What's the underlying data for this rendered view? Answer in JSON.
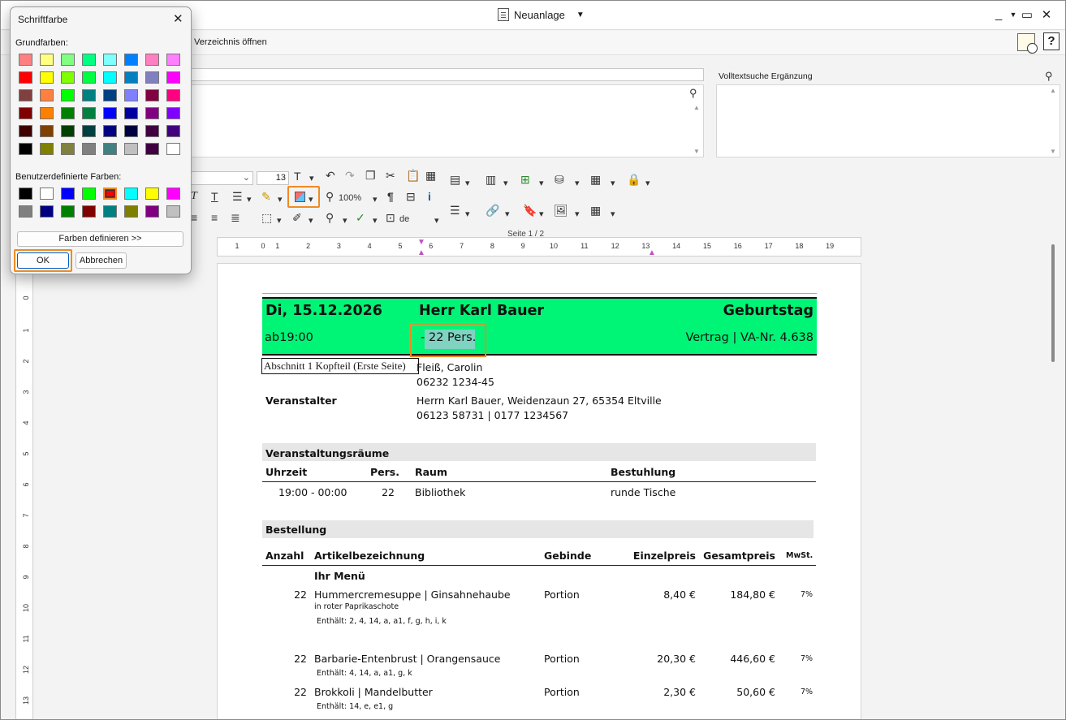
{
  "window": {
    "title": "Neuanlage",
    "menu_link": "Verzeichnis öffnen",
    "help_label": "?"
  },
  "search": {
    "fulltext_label": "Volltextsuche Ergänzung"
  },
  "toolbar": {
    "font_size": "13",
    "zoom": "100%",
    "language": "de",
    "page_indicator": "Seite 1 / 2"
  },
  "ruler": {
    "h_labels": [
      "1",
      "1",
      "2",
      "3",
      "4",
      "5",
      "6",
      "7",
      "8",
      "9",
      "10",
      "11",
      "12",
      "13",
      "14",
      "15",
      "16",
      "17",
      "18",
      "19"
    ],
    "v_labels": [
      "1",
      "1",
      "2",
      "3",
      "4",
      "5",
      "6",
      "7",
      "8",
      "9",
      "10",
      "11",
      "12",
      "13"
    ]
  },
  "document": {
    "header": {
      "date": "Di, 15.12.2026",
      "guest": "Herr Karl Bauer",
      "occasion": "Geburtstag",
      "time": "ab19:00",
      "dash": "-",
      "persons": "22 Pers.",
      "contract": "Vertrag | VA-Nr. 4.638"
    },
    "section_label": "Abschnitt 1 Kopfteil (Erste Seite)",
    "contact_name": "Fleiß, Carolin",
    "contact_phone": "06232 1234-45",
    "organizer_label": "Veranstalter",
    "organizer_address": "Herrn Karl Bauer, Weidenzaun 27, 65354 Eltville",
    "organizer_phone": "06123 58731 | 0177 1234567",
    "rooms": {
      "title": "Veranstaltungsräume",
      "headers": {
        "time": "Uhrzeit",
        "persons": "Pers.",
        "room": "Raum",
        "seating": "Bestuhlung"
      },
      "row": {
        "time": "19:00 - 00:00",
        "persons": "22",
        "room": "Bibliothek",
        "seating": "runde Tische"
      }
    },
    "order": {
      "title": "Bestellung",
      "headers": {
        "qty": "Anzahl",
        "item": "Artikelbezeichnung",
        "unit": "Gebinde",
        "price": "Einzelpreis",
        "total": "Gesamtpreis",
        "vat": "MwSt."
      },
      "menu_title": "Ihr Menü",
      "items": [
        {
          "qty": "22",
          "name": "Hummercremesuppe | Ginsahnehaube",
          "sub": "in roter Paprikaschote",
          "contains": "Enthält: 2, 4, 14, a, a1, f, g, h, i, k",
          "unit": "Portion",
          "price": "8,40 €",
          "total": "184,80 €",
          "vat": "7%"
        },
        {
          "qty": "22",
          "name": "Barbarie-Entenbrust | Orangensauce",
          "sub": "",
          "contains": "Enthält: 4, 14, a, a1, g, k",
          "unit": "Portion",
          "price": "20,30 €",
          "total": "446,60 €",
          "vat": "7%"
        },
        {
          "qty": "22",
          "name": "Brokkoli | Mandelbutter",
          "sub": "",
          "contains": "Enthält: 14, e, e1, g",
          "unit": "Portion",
          "price": "2,30 €",
          "total": "50,60 €",
          "vat": "7%"
        }
      ]
    }
  },
  "dialog": {
    "title": "Schriftfarbe",
    "basic_label": "Grundfarben:",
    "custom_label": "Benutzerdefinierte Farben:",
    "define_button": "Farben definieren >>",
    "ok_button": "OK",
    "cancel_button": "Abbrechen",
    "basic_colors": [
      "#ff8080",
      "#ffff80",
      "#80ff80",
      "#00ff80",
      "#80ffff",
      "#0080ff",
      "#ff80c0",
      "#ff80ff",
      "#ff0000",
      "#ffff00",
      "#80ff00",
      "#00ff40",
      "#00ffff",
      "#0080c0",
      "#8080c0",
      "#ff00ff",
      "#804040",
      "#ff8040",
      "#00ff00",
      "#008080",
      "#004080",
      "#8080ff",
      "#800040",
      "#ff0080",
      "#800000",
      "#ff8000",
      "#008000",
      "#008040",
      "#0000ff",
      "#0000a0",
      "#800080",
      "#8000ff",
      "#400000",
      "#804000",
      "#004000",
      "#004040",
      "#000080",
      "#000040",
      "#400040",
      "#400080",
      "#000000",
      "#808000",
      "#808040",
      "#808080",
      "#408080",
      "#c0c0c0",
      "#400040",
      "#ffffff"
    ],
    "custom_colors": [
      "#000000",
      "#ffffff",
      "#0000ff",
      "#00ff00",
      "#ff0000",
      "#00ffff",
      "#ffff00",
      "#ff00ff",
      "#808080",
      "#000080",
      "#008000",
      "#800000",
      "#008080",
      "#808000",
      "#800080",
      "#c0c0c0"
    ],
    "selected_custom_index": 4
  }
}
